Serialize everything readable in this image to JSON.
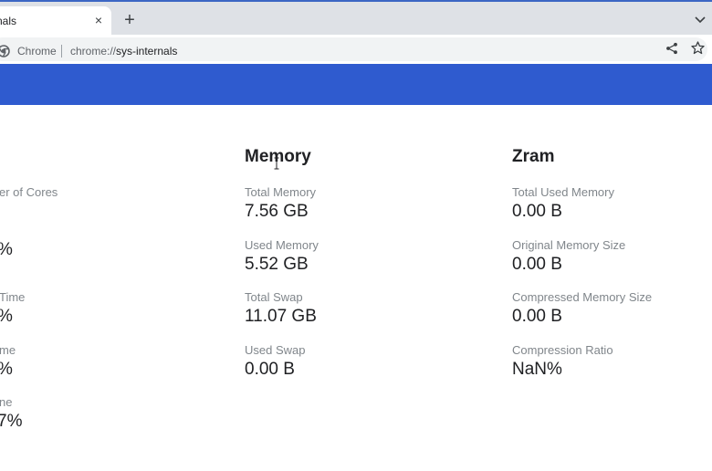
{
  "tab": {
    "title": "rnals",
    "close": "×"
  },
  "new_tab": "+",
  "omnibox": {
    "site": "Chrome",
    "url_scheme": "chrome://",
    "url_path": "sys-internals"
  },
  "cpu": {
    "items": [
      {
        "label": "er of Cores",
        "value": ""
      },
      {
        "label": "",
        "value": "%"
      },
      {
        "label": "Time",
        "value": "%"
      },
      {
        "label": "me",
        "value": "%"
      },
      {
        "label": "ne",
        "value": "7%"
      }
    ]
  },
  "memory": {
    "title": "Memory",
    "items": [
      {
        "label": "Total Memory",
        "value": "7.56 GB"
      },
      {
        "label": "Used Memory",
        "value": "5.52 GB"
      },
      {
        "label": "Total Swap",
        "value": "11.07 GB"
      },
      {
        "label": "Used Swap",
        "value": "0.00 B"
      }
    ]
  },
  "zram": {
    "title": "Zram",
    "items": [
      {
        "label": "Total Used Memory",
        "value": "0.00 B"
      },
      {
        "label": "Original Memory Size",
        "value": "0.00 B"
      },
      {
        "label": "Compressed Memory Size",
        "value": "0.00 B"
      },
      {
        "label": "Compression Ratio",
        "value": "NaN%"
      }
    ]
  },
  "colors": {
    "banner": "#2f5bcf",
    "tabstrip": "#dee1e6",
    "label": "#80868b",
    "value": "#202124"
  },
  "icons": [
    "close-icon",
    "plus-icon",
    "chevron-down-icon",
    "chrome-logo-icon",
    "share-icon",
    "star-icon",
    "text-cursor-icon"
  ]
}
